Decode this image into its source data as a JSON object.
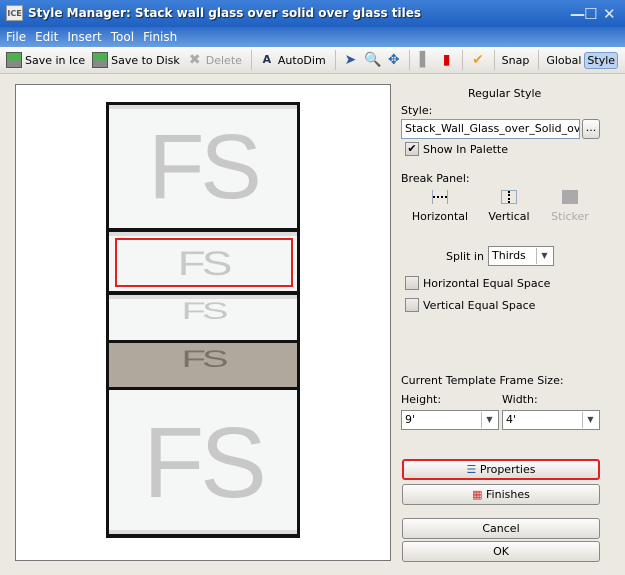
{
  "window": {
    "title": "Style Manager: Stack wall glass over solid  over glass tiles",
    "app_icon": "ICE"
  },
  "menu": [
    "File",
    "Edit",
    "Insert",
    "Tool",
    "Finish"
  ],
  "toolbar": {
    "save_in_ice": "Save in Ice",
    "save_to_disk": "Save to Disk",
    "delete": "Delete",
    "autodim": "AutoDim",
    "snap": "Snap",
    "global": "Global",
    "style": "Style"
  },
  "preview": {
    "tile_label": "FS",
    "tile_colors": [
      "#f5f7f6",
      "#f5f7f6",
      "#f5f7f6",
      "#b0a89c",
      "#f5f7f6"
    ],
    "selection_color": "#e32020"
  },
  "panel": {
    "heading": "Regular Style",
    "style_label": "Style:",
    "style_value": "Stack_Wall_Glass_over_Solid_over_Glass",
    "browse": "...",
    "show_in_palette": "Show In Palette",
    "show_in_palette_checked": true,
    "break_panel": "Break Panel:",
    "horizontal": "Horizontal",
    "vertical": "Vertical",
    "sticker": "Sticker",
    "split_in": "Split in",
    "split_value": "Thirds",
    "h_equal": "Horizontal Equal Space",
    "v_equal": "Vertical Equal Space",
    "frame_size": "Current Template Frame Size:",
    "height_label": "Height:",
    "height_value": "9'",
    "width_label": "Width:",
    "width_value": "4'",
    "properties": "Properties",
    "finishes": "Finishes",
    "cancel": "Cancel",
    "ok": "OK"
  }
}
